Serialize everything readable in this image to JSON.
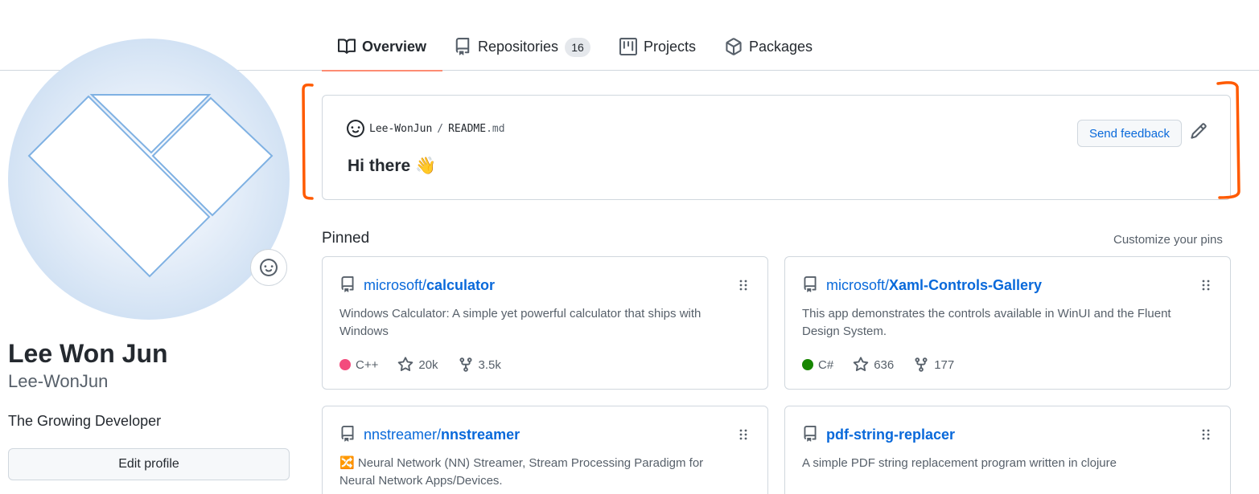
{
  "nav": {
    "tabs": [
      {
        "label": "Overview",
        "icon": "book-icon",
        "active": true
      },
      {
        "label": "Repositories",
        "icon": "repo-icon",
        "count": "16"
      },
      {
        "label": "Projects",
        "icon": "project-icon"
      },
      {
        "label": "Packages",
        "icon": "package-icon"
      }
    ]
  },
  "profile": {
    "name": "Lee Won Jun",
    "login": "Lee-WonJun",
    "bio": "The Growing Developer",
    "edit_label": "Edit profile"
  },
  "readme": {
    "owner": "Lee-WonJun",
    "separator": "/",
    "file": "README",
    "ext": ".md",
    "heading": "Hi there",
    "heading_emoji": "👋",
    "feedback_label": "Send feedback"
  },
  "pinned": {
    "title": "Pinned",
    "customize_label": "Customize your pins",
    "repos": [
      {
        "owner": "microsoft/",
        "name": "calculator",
        "description": "Windows Calculator: A simple yet powerful calculator that ships with Windows",
        "language": "C++",
        "language_color": "#f34b7d",
        "stars": "20k",
        "forks": "3.5k"
      },
      {
        "owner": "microsoft/",
        "name": "Xaml-Controls-Gallery",
        "description": "This app demonstrates the controls available in WinUI and the Fluent Design System.",
        "language": "C#",
        "language_color": "#178600",
        "stars": "636",
        "forks": "177"
      },
      {
        "owner": "nnstreamer/",
        "name": "nnstreamer",
        "description_emoji": "🔀",
        "description": "Neural Network (NN) Streamer, Stream Processing Paradigm for Neural Network Apps/Devices."
      },
      {
        "owner": "",
        "name": "pdf-string-replacer",
        "description": "A simple PDF string replacement program written in clojure"
      }
    ]
  },
  "colors": {
    "accent": "#0969da",
    "tab_underline": "#fd8c73",
    "annotation": "#ff5a00"
  }
}
